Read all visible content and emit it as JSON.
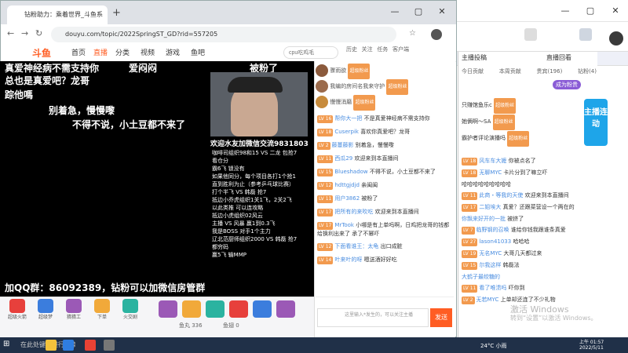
{
  "browser": {
    "tab_title": "钻粉助力：乘着世界_斗鱼系",
    "url": "douyu.com/topic/2022SpringST_GD?rid=557205",
    "search_placeholder": "cpu吃鸡毛"
  },
  "site": {
    "logo": "斗鱼",
    "nav": [
      "首页",
      "直播",
      "分类",
      "视频",
      "游戏",
      "鱼吧"
    ],
    "header_icons": [
      "历史",
      "关注",
      "任务",
      "客户端"
    ]
  },
  "video": {
    "overlay_lines": [
      "真爱神经病不需支持你",
      "爱闷闷",
      "被粉了",
      "总也是真爱吧？龙哥",
      "踪他嗎",
      "别着急，慢慢嚟",
      "不得不说，小土豆都不来了"
    ],
    "cam_caption": "欢迎水友加微信交流9831803",
    "info_lines": [
      "咖啡司组织98和15 VS 二龙 包抢7",
      "看仓分",
      "霸6飞 锁没有",
      "如果他同分，每个项目各打1个抢1",
      "直到胜利为止（参考乒乓球比赛）",
      "打个半飞 VS 韩磊 抢7",
      "抵边小乔虎组织1关1飞，2关2飞",
      "以此类推 可以连攻略",
      "抵边小虎组织02风云",
      "主播 VS 风暴 赢1到0.3飞",
      "我是BOSS 对手1个主力",
      "辽北范厨师组织2000 VS 韩磊 抢7",
      "都穷码",
      "赢5飞 输MMP"
    ],
    "qq_group": "加QQ群：86092389，钻粉可以加微信房管群"
  },
  "gifts": {
    "labels": [
      "超级火箭",
      "超级梦",
      "猜猜工",
      "下单",
      "火交剧"
    ],
    "counts": [
      "鱼丸 336",
      "鱼翅 0"
    ]
  },
  "chat": {
    "ranks": [
      {
        "name": "骤雨欲",
        "badge": "超级粉丝"
      },
      {
        "name": "我编的房间名我来守护",
        "badge": "超级粉丝"
      },
      {
        "name": "慢慢消磨",
        "badge": "超级粉丝"
      }
    ],
    "messages": [
      {
        "lv": "LV 16",
        "user": "帮你大一把",
        "text": "不是真爱神经病不需支持你"
      },
      {
        "lv": "LV 18",
        "user": "Cuserpik",
        "text": "喜欢你真爱吧？龙哥"
      },
      {
        "lv": "LV 2",
        "user": "藤蔓藤影",
        "text": "别着急，慢慢嚟"
      },
      {
        "lv": "LV 11",
        "user": "西瓜29",
        "text": "欢迎来到本直播间"
      },
      {
        "lv": "LV 15",
        "user": "Blueshadow",
        "text": "不得不说，小土豆都不来了"
      },
      {
        "lv": "LV 12",
        "user": "hdttgjdjd",
        "text": "亲闽闽"
      },
      {
        "lv": "LV 11",
        "user": "用户3862",
        "text": "被粉了"
      },
      {
        "lv": "LV 17",
        "user": "把所有的来吹吃",
        "text": "欢迎来到本直播间"
      },
      {
        "lv": "LV 17",
        "user": "MrTook",
        "text": "小哪是有上单吗啊，日鸡把龙哥的钱都给换利出来了 承了不幂吓"
      },
      {
        "lv": "LV 12",
        "user": "下面看谁王：太龟",
        "text": "出口成脏"
      },
      {
        "lv": "LV 14",
        "user": "叶来叶的呀",
        "text": "嗯送酒好好吃"
      }
    ],
    "input_placeholder": "这里输入*发生的，可以关注主播",
    "send_label": "发送"
  },
  "rightwin": {
    "tabs": [
      "今日贡献",
      "本周贡献",
      "贵宾(196)",
      "钻粉(4)"
    ],
    "title": "主播投稿",
    "subtitle": "直播回看",
    "badge": "成为粉贵",
    "side_banner": "主播连动",
    "list": [
      {
        "name": "只赚馆鱼乐c",
        "badge": "超级粉丝"
      },
      {
        "name": "她俩啊～SA",
        "badge": "超级粉丝"
      },
      {
        "name": "霸护者评论演播吗",
        "badge": "超级粉丝"
      }
    ],
    "messages": [
      {
        "lv": "LV 18",
        "user": "风车车大嬷",
        "text": "你被点名了"
      },
      {
        "lv": "LV 18",
        "user": "无聊MYC",
        "text": "卡片分到了嘛立吓"
      },
      {
        "lv": "",
        "user": "",
        "text": "哈哈哈哈哈哈哈哈哈"
      },
      {
        "lv": "LV 11",
        "user": "此商・等我的天使",
        "text": "欢迎来到本直播间"
      },
      {
        "lv": "LV 17",
        "user": "二姐埃大",
        "text": "真爱？还跟菜营设一个两在的"
      },
      {
        "lv": "",
        "user": "你飘来好开的一批",
        "text": "被挤了"
      },
      {
        "lv": "LV 7",
        "user": "临野钢的召唤",
        "text": "谁给你钱我跟谁条真爱"
      },
      {
        "lv": "LV 27",
        "user": "lason41033",
        "text": "哈哈哈"
      },
      {
        "lv": "LV 19",
        "user": "无名MYC",
        "text": "大哥几天都过来"
      },
      {
        "lv": "LV 15",
        "user": "尔我这样",
        "text": "韩磊法"
      },
      {
        "lv": "",
        "user": "大鹤子最绞糖的",
        "text": ""
      },
      {
        "lv": "LV 11",
        "user": "看了唯溃吗",
        "text": "吓你到"
      },
      {
        "lv": "LV 2",
        "user": "无若MYC",
        "text": "上单却还连了不少礼物"
      }
    ],
    "watermark": [
      "激活 Windows",
      "转到“设置”以激活 Windows。"
    ]
  },
  "taskbar": {
    "weather": "24°C 小雨",
    "time": "上午 01:57",
    "date": "2022/5/11",
    "search_hint": "在此处键入进行搜索"
  },
  "colors": {
    "accent": "#ff5d23",
    "badge_orange": "#f29a4e",
    "link_blue": "#4a8de0"
  }
}
